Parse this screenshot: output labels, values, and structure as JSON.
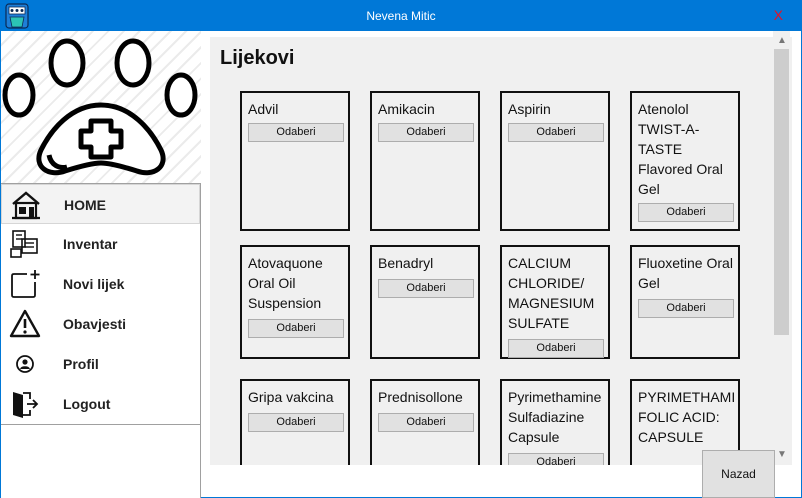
{
  "window": {
    "title": "Nevena Mitic",
    "close_label": "X"
  },
  "nav": [
    {
      "label": "HOME",
      "icon": "home-icon",
      "active": true
    },
    {
      "label": "Inventar",
      "icon": "inventory-icon"
    },
    {
      "label": "Novi lijek",
      "icon": "new-item-icon"
    },
    {
      "label": "Obavjesti",
      "icon": "warning-icon"
    },
    {
      "label": "Profil",
      "icon": "user-icon"
    },
    {
      "label": "Logout",
      "icon": "logout-icon"
    }
  ],
  "main": {
    "heading": "Lijekovi",
    "select_label": "Odaberi",
    "medicines": [
      "Advil",
      "Amikacin",
      "Aspirin",
      "Atenolol TWIST-A-TASTE Flavored Oral Gel",
      "Atovaquone Oral Oil Suspension",
      "Benadryl",
      "CALCIUM CHLORIDE/ MAGNESIUM SULFATE",
      "Fluoxetine Oral Gel",
      "Gripa vakcina",
      "Prednisollone",
      "Pyrimethamine Sulfadiazine Capsule",
      "PYRIMETHAMI FOLIC ACID: CAPSULE"
    ]
  },
  "footer": {
    "back_label": "Nazad"
  },
  "colors": {
    "titlebar": "#0078d7",
    "close": "#e81123",
    "content_bg": "#f0f0f0"
  }
}
